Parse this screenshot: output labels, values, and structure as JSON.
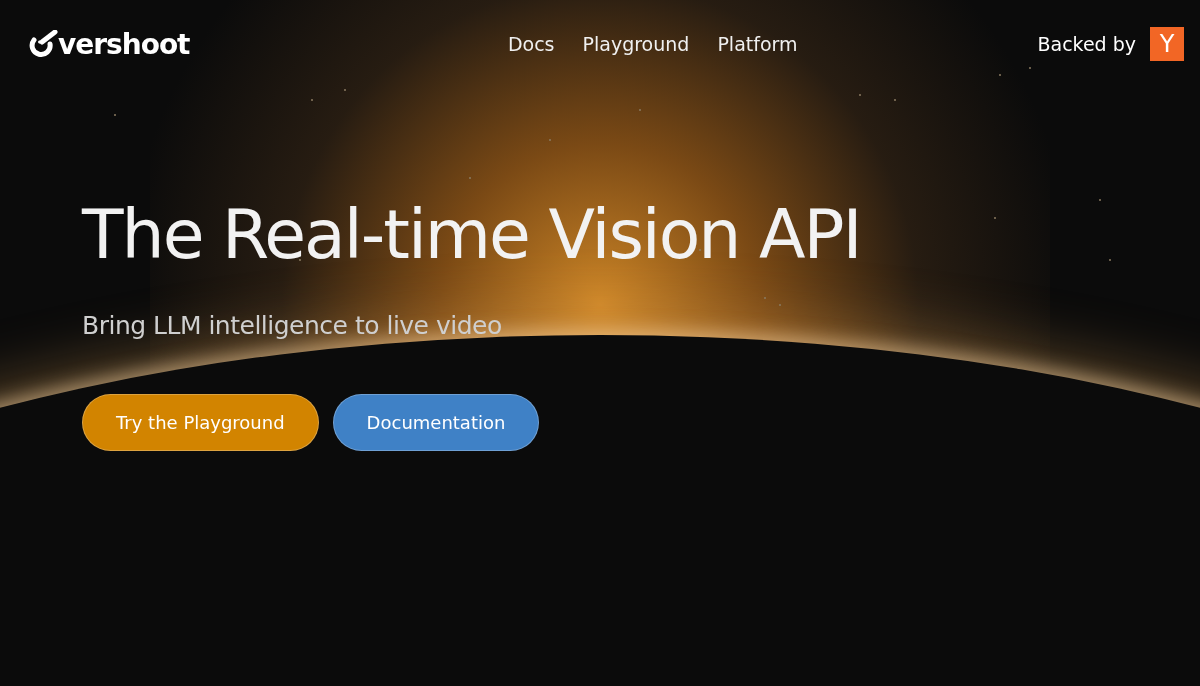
{
  "header": {
    "logo_text": "vershoot",
    "nav": [
      {
        "label": "Docs"
      },
      {
        "label": "Playground"
      },
      {
        "label": "Platform"
      }
    ],
    "backed_by": "Backed by",
    "badge": "Y"
  },
  "hero": {
    "title": "The Real-time Vision API",
    "subtitle": "Bring LLM intelligence to live video",
    "buttons": [
      {
        "label": "Try the Playground",
        "kind": "primary"
      },
      {
        "label": "Documentation",
        "kind": "secondary"
      }
    ]
  }
}
